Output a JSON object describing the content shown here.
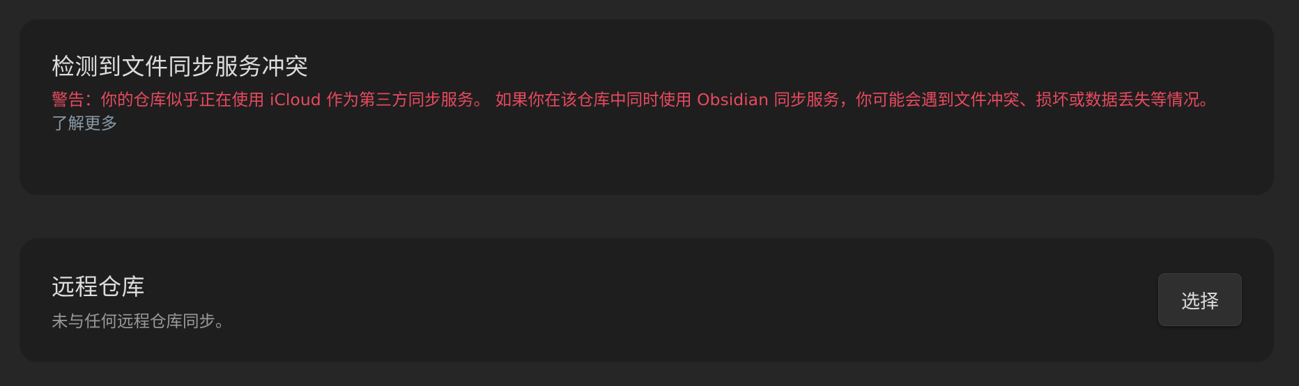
{
  "conflict": {
    "title": "检测到文件同步服务冲突",
    "warning": "警告：你的仓库似乎正在使用 iCloud 作为第三方同步服务。 如果你在该仓库中同时使用 Obsidian 同步服务，你可能会遇到文件冲突、损坏或数据丢失等情况。",
    "learn_more": "了解更多"
  },
  "remote": {
    "title": "远程仓库",
    "description": "未与任何远程仓库同步。",
    "choose_label": "选择"
  },
  "colors": {
    "background": "#262626",
    "card": "#1e1e1e",
    "warning": "#e64a5f",
    "link": "#8a9aa6"
  }
}
